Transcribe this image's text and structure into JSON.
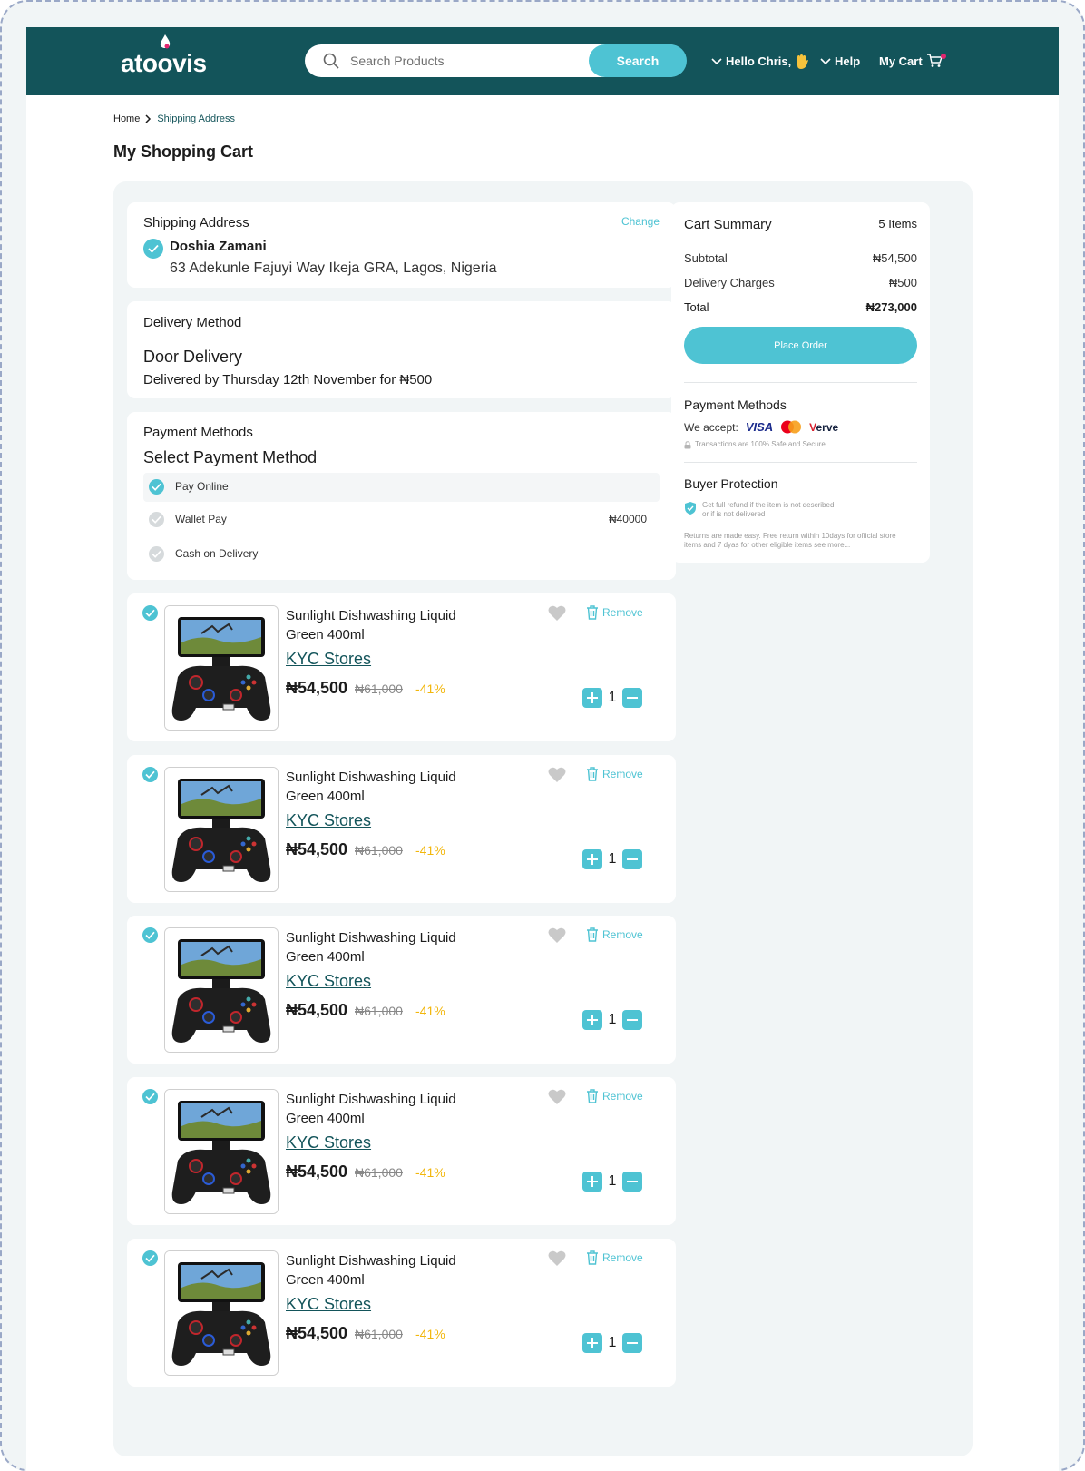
{
  "header": {
    "logo": "atoovis",
    "search_placeholder": "Search Products",
    "search_button": "Search",
    "greeting": "Hello Chris,",
    "help": "Help",
    "cart": "My Cart"
  },
  "breadcrumb": [
    "Home",
    "Shipping Address"
  ],
  "page_title": "My Shopping Cart",
  "shipping": {
    "label": "Shipping Address",
    "change": "Change",
    "name": "Doshia Zamani",
    "address": "63 Adekunle Fajuyi Way Ikeja GRA, Lagos, Nigeria"
  },
  "delivery": {
    "label": "Delivery Method",
    "method": "Door Delivery",
    "detail": "Delivered by Thursday 12th November for ₦500"
  },
  "payment": {
    "label": "Payment Methods",
    "title": "Select Payment Method",
    "options": [
      {
        "label": "Pay Online",
        "amount": "",
        "selected": true
      },
      {
        "label": "Wallet Pay",
        "amount": "₦40000",
        "selected": false
      },
      {
        "label": "Cash on Delivery",
        "amount": "",
        "selected": false
      }
    ]
  },
  "items": [
    {
      "name": "Sunlight Dishwashing Liquid Green 400ml",
      "store": "KYC Stores",
      "price": "₦54,500",
      "old_price": "₦61,000",
      "discount": "-41%",
      "qty": "1",
      "remove": "Remove"
    },
    {
      "name": "Sunlight Dishwashing Liquid Green 400ml",
      "store": "KYC Stores",
      "price": "₦54,500",
      "old_price": "₦61,000",
      "discount": "-41%",
      "qty": "1",
      "remove": "Remove"
    },
    {
      "name": "Sunlight Dishwashing Liquid Green 400ml",
      "store": "KYC Stores",
      "price": "₦54,500",
      "old_price": "₦61,000",
      "discount": "-41%",
      "qty": "1",
      "remove": "Remove"
    },
    {
      "name": "Sunlight Dishwashing Liquid Green 400ml",
      "store": "KYC Stores",
      "price": "₦54,500",
      "old_price": "₦61,000",
      "discount": "-41%",
      "qty": "1",
      "remove": "Remove"
    },
    {
      "name": "Sunlight Dishwashing Liquid Green 400ml",
      "store": "KYC Stores",
      "price": "₦54,500",
      "old_price": "₦61,000",
      "discount": "-41%",
      "qty": "1",
      "remove": "Remove"
    }
  ],
  "summary": {
    "title": "Cart Summary",
    "count": "5 Items",
    "subtotal_label": "Subtotal",
    "subtotal": "₦54,500",
    "delivery_label": "Delivery Charges",
    "delivery": "₦500",
    "total_label": "Total",
    "total": "₦273,000",
    "place_order": "Place Order",
    "payment_title": "Payment Methods",
    "we_accept": "We accept:",
    "card_visa": "VISA",
    "card_verve_v": "V",
    "card_verve_rest": "erve",
    "secure": "Transactions are 100% Safe and Secure",
    "buyer_title": "Buyer Protection",
    "refund_line1": "Get full refund if the item is not described",
    "refund_line2": "or if is not delivered",
    "returns_line1": "Returns are made easy. Free return within 10days for official store",
    "returns_line2": "items and 7 dyas for other eligible items see more..."
  },
  "colors": {
    "header": "#13545a",
    "accent": "#4ec3d3",
    "discount": "#f2b70d",
    "panel": "#f1f5f6"
  }
}
